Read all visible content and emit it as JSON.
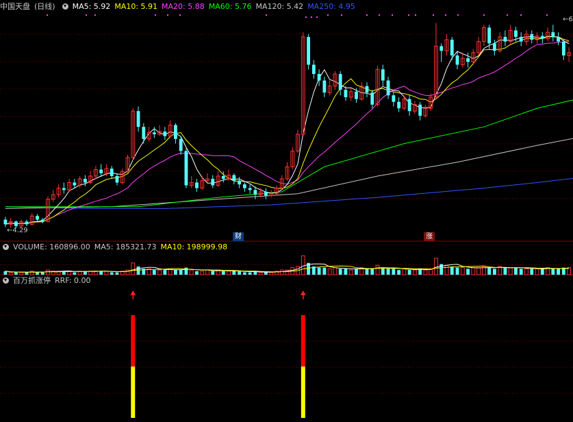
{
  "header": {
    "stock_name": "中国天盘",
    "period": "(日线)",
    "ma": [
      {
        "label": "MA5: 5.92",
        "color": "#ffffff"
      },
      {
        "label": "MA10: 5.91",
        "color": "#ffff00"
      },
      {
        "label": "MA20: 5.88",
        "color": "#ff44ff"
      },
      {
        "label": "MA60: 5.76",
        "color": "#00ff00"
      },
      {
        "label": "MA120: 5.42",
        "color": "#c8c8c8"
      },
      {
        "label": "MA250: 4.95",
        "color": "#3355ff"
      }
    ]
  },
  "volume_header": {
    "title": "VOLUME: 160896.00",
    "ma5": "MA5: 185321.73",
    "ma10": "MA10: 198999.98"
  },
  "indicator_header": {
    "title": "百万抓涨停",
    "value": "RRF: 0.00"
  },
  "markers": {
    "low_price": "4.29",
    "high_price_partial": "6",
    "tag_cai": "财",
    "tag_zhang": "涨"
  },
  "colors": {
    "up": "#ff3333",
    "down": "#54ffff",
    "grid": "#8b0000",
    "bar_top": "#ff0000",
    "bar_bottom": "#ffff00",
    "arrow": "#ff2020"
  },
  "chart_data": {
    "type": "candlestick",
    "price_ylim": [
      4.2,
      6.6
    ],
    "candles": [
      [
        4.38,
        4.33,
        4.41,
        4.3
      ],
      [
        4.33,
        4.36,
        4.4,
        4.29
      ],
      [
        4.36,
        4.31,
        4.37,
        4.29
      ],
      [
        4.31,
        4.36,
        4.38,
        4.3
      ],
      [
        4.36,
        4.33,
        4.38,
        4.31
      ],
      [
        4.33,
        4.42,
        4.45,
        4.32
      ],
      [
        4.42,
        4.38,
        4.44,
        4.35
      ],
      [
        4.38,
        4.36,
        4.4,
        4.34
      ],
      [
        4.36,
        4.6,
        4.63,
        4.35
      ],
      [
        4.6,
        4.65,
        4.7,
        4.57
      ],
      [
        4.65,
        4.72,
        4.76,
        4.62
      ],
      [
        4.72,
        4.7,
        4.78,
        4.66
      ],
      [
        4.7,
        4.78,
        4.82,
        4.68
      ],
      [
        4.78,
        4.75,
        4.82,
        4.72
      ],
      [
        4.75,
        4.82,
        4.85,
        4.72
      ],
      [
        4.82,
        4.78,
        4.86,
        4.74
      ],
      [
        4.78,
        4.85,
        4.9,
        4.76
      ],
      [
        4.85,
        4.92,
        4.96,
        4.82
      ],
      [
        4.92,
        4.88,
        4.98,
        4.84
      ],
      [
        4.88,
        4.93,
        4.98,
        4.85
      ],
      [
        4.93,
        4.85,
        4.96,
        4.82
      ],
      [
        4.85,
        4.78,
        4.88,
        4.75
      ],
      [
        4.78,
        4.9,
        4.93,
        4.76
      ],
      [
        4.9,
        5.05,
        5.08,
        4.88
      ],
      [
        5.05,
        5.55,
        5.58,
        5.02
      ],
      [
        5.55,
        5.38,
        5.6,
        5.33
      ],
      [
        5.38,
        5.25,
        5.42,
        5.2
      ],
      [
        5.25,
        5.32,
        5.38,
        5.22
      ],
      [
        5.32,
        5.3,
        5.38,
        5.26
      ],
      [
        5.3,
        5.33,
        5.4,
        5.28
      ],
      [
        5.33,
        5.28,
        5.38,
        5.24
      ],
      [
        5.28,
        5.4,
        5.45,
        5.26
      ],
      [
        5.4,
        5.25,
        5.42,
        5.2
      ],
      [
        5.25,
        5.12,
        5.28,
        5.08
      ],
      [
        5.12,
        4.75,
        5.15,
        4.72
      ],
      [
        4.75,
        4.78,
        4.85,
        4.72
      ],
      [
        4.78,
        4.72,
        4.82,
        4.68
      ],
      [
        4.72,
        4.8,
        4.85,
        4.7
      ],
      [
        4.8,
        4.82,
        4.88,
        4.78
      ],
      [
        4.82,
        4.75,
        4.86,
        4.72
      ],
      [
        4.75,
        4.85,
        4.9,
        4.73
      ],
      [
        4.85,
        4.82,
        4.9,
        4.78
      ],
      [
        4.82,
        4.86,
        4.92,
        4.8
      ],
      [
        4.86,
        4.8,
        4.88,
        4.76
      ],
      [
        4.8,
        4.76,
        4.84,
        4.72
      ],
      [
        4.76,
        4.72,
        4.78,
        4.68
      ],
      [
        4.72,
        4.7,
        4.76,
        4.66
      ],
      [
        4.7,
        4.65,
        4.74,
        4.6
      ],
      [
        4.65,
        4.68,
        4.72,
        4.62
      ],
      [
        4.68,
        4.64,
        4.72,
        4.6
      ],
      [
        4.64,
        4.66,
        4.7,
        4.62
      ],
      [
        4.66,
        4.72,
        4.75,
        4.64
      ],
      [
        4.72,
        4.82,
        4.86,
        4.7
      ],
      [
        4.82,
        4.95,
        5.0,
        4.8
      ],
      [
        4.95,
        5.12,
        5.16,
        4.92
      ],
      [
        5.12,
        5.3,
        5.35,
        5.1
      ],
      [
        5.3,
        6.35,
        6.4,
        5.28
      ],
      [
        6.35,
        6.05,
        6.38,
        6.0
      ],
      [
        6.05,
        5.95,
        6.1,
        5.9
      ],
      [
        5.95,
        5.88,
        6.0,
        5.82
      ],
      [
        5.88,
        5.75,
        5.92,
        5.7
      ],
      [
        5.75,
        5.82,
        5.88,
        5.72
      ],
      [
        5.82,
        5.95,
        5.98,
        5.78
      ],
      [
        5.95,
        5.78,
        5.98,
        5.72
      ],
      [
        5.78,
        5.7,
        5.82,
        5.66
      ],
      [
        5.7,
        5.76,
        5.8,
        5.66
      ],
      [
        5.76,
        5.68,
        5.8,
        5.64
      ],
      [
        5.68,
        5.82,
        5.86,
        5.66
      ],
      [
        5.82,
        5.75,
        5.86,
        5.7
      ],
      [
        5.75,
        5.62,
        5.78,
        5.58
      ],
      [
        5.62,
        6.0,
        6.04,
        5.6
      ],
      [
        6.0,
        5.88,
        6.05,
        5.82
      ],
      [
        5.88,
        5.72,
        5.92,
        5.68
      ],
      [
        5.72,
        5.65,
        5.76,
        5.6
      ],
      [
        5.65,
        5.58,
        5.7,
        5.54
      ],
      [
        5.58,
        5.68,
        5.72,
        5.56
      ],
      [
        5.68,
        5.55,
        5.72,
        5.5
      ],
      [
        5.55,
        5.62,
        5.66,
        5.52
      ],
      [
        5.62,
        5.5,
        5.65,
        5.45
      ],
      [
        5.5,
        5.58,
        5.62,
        5.48
      ],
      [
        5.58,
        5.7,
        5.74,
        5.55
      ],
      [
        5.7,
        6.25,
        6.5,
        5.68
      ],
      [
        6.25,
        6.2,
        6.28,
        6.08
      ],
      [
        6.2,
        6.32,
        6.38,
        6.15
      ],
      [
        6.32,
        6.15,
        6.35,
        6.1
      ],
      [
        6.15,
        6.05,
        6.2,
        6.0
      ],
      [
        6.05,
        6.12,
        6.18,
        6.02
      ],
      [
        6.12,
        6.08,
        6.18,
        6.02
      ],
      [
        6.08,
        6.18,
        6.22,
        6.05
      ],
      [
        6.18,
        6.3,
        6.35,
        6.15
      ],
      [
        6.3,
        6.45,
        6.48,
        6.25
      ],
      [
        6.45,
        6.28,
        6.48,
        6.22
      ],
      [
        6.28,
        6.2,
        6.32,
        6.15
      ],
      [
        6.2,
        6.35,
        6.4,
        6.18
      ],
      [
        6.35,
        6.3,
        6.42,
        6.25
      ],
      [
        6.3,
        6.42,
        6.48,
        6.28
      ],
      [
        6.42,
        6.35,
        6.46,
        6.3
      ],
      [
        6.35,
        6.3,
        6.4,
        6.25
      ],
      [
        6.3,
        6.38,
        6.42,
        6.26
      ],
      [
        6.38,
        6.32,
        6.42,
        6.28
      ],
      [
        6.32,
        6.36,
        6.4,
        6.28
      ],
      [
        6.36,
        6.33,
        6.4,
        6.28
      ],
      [
        6.33,
        6.4,
        6.45,
        6.3
      ],
      [
        6.4,
        6.35,
        6.48,
        6.3
      ],
      [
        6.35,
        6.3,
        6.4,
        6.26
      ],
      [
        6.3,
        6.15,
        6.32,
        6.1
      ],
      [
        6.15,
        6.18,
        6.24,
        6.08
      ]
    ],
    "ma_lines": [
      {
        "name": "MA250",
        "color": "#3355ff",
        "pts": [
          [
            0,
            4.52
          ],
          [
            15,
            4.5
          ],
          [
            30,
            4.5
          ],
          [
            50,
            4.54
          ],
          [
            70,
            4.62
          ],
          [
            90,
            4.72
          ],
          [
            100,
            4.78
          ],
          [
            109,
            4.84
          ]
        ]
      },
      {
        "name": "MA120",
        "color": "#c8c8c8",
        "pts": [
          [
            0,
            4.5
          ],
          [
            20,
            4.52
          ],
          [
            40,
            4.6
          ],
          [
            55,
            4.66
          ],
          [
            70,
            4.85
          ],
          [
            85,
            5.0
          ],
          [
            100,
            5.18
          ],
          [
            109,
            5.28
          ]
        ]
      },
      {
        "name": "MA60",
        "color": "#00ff00",
        "pts": [
          [
            0,
            4.52
          ],
          [
            25,
            4.52
          ],
          [
            40,
            4.62
          ],
          [
            52,
            4.68
          ],
          [
            60,
            4.95
          ],
          [
            75,
            5.2
          ],
          [
            90,
            5.38
          ],
          [
            100,
            5.58
          ],
          [
            109,
            5.7
          ]
        ]
      }
    ],
    "volume": [
      3,
      2,
      2,
      2,
      2,
      3,
      2,
      2,
      4,
      3,
      3,
      3,
      3,
      2,
      3,
      3,
      3,
      3,
      3,
      3,
      2,
      2,
      3,
      4,
      10,
      7,
      5,
      5,
      4,
      4,
      4,
      5,
      4,
      4,
      6,
      4,
      3,
      3,
      4,
      3,
      4,
      3,
      3,
      3,
      3,
      2,
      2,
      3,
      2,
      2,
      2,
      3,
      4,
      4,
      6,
      7,
      16,
      10,
      7,
      6,
      6,
      5,
      6,
      5,
      5,
      4,
      5,
      6,
      5,
      5,
      8,
      6,
      5,
      5,
      4,
      5,
      4,
      4,
      5,
      4,
      5,
      14,
      9,
      8,
      7,
      6,
      6,
      5,
      6,
      6,
      7,
      6,
      5,
      7,
      6,
      6,
      6,
      5,
      5,
      5,
      5,
      5,
      6,
      5,
      5,
      6,
      6
    ],
    "volume_ylim": [
      0,
      18
    ],
    "signals": [
      24,
      56
    ],
    "signal_split": 0.5
  }
}
